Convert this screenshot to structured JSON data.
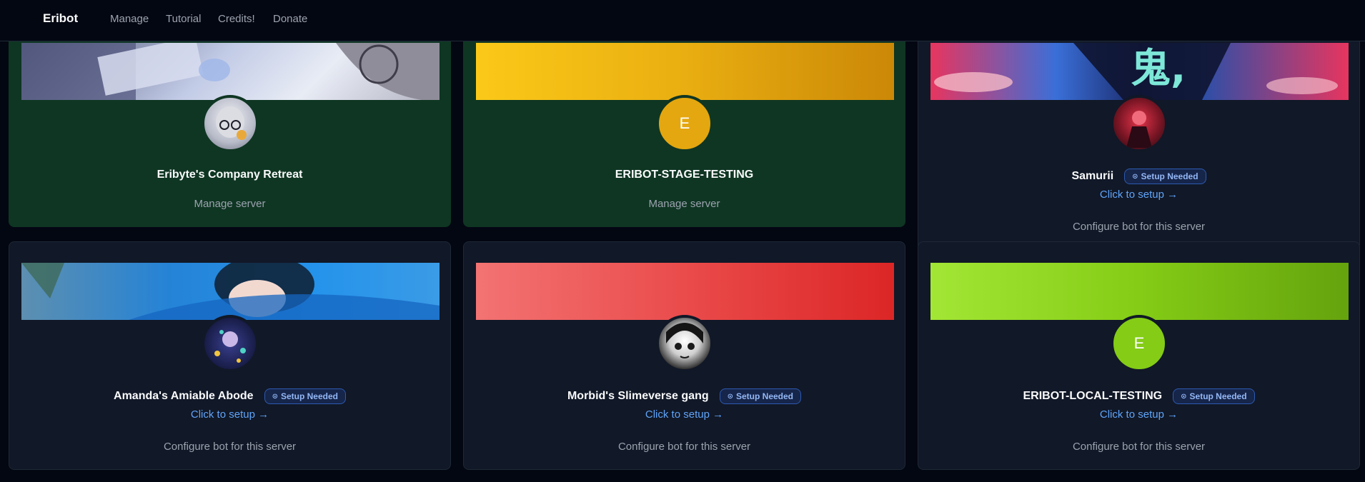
{
  "nav": {
    "brand": "Eribot",
    "links": [
      "Manage",
      "Tutorial",
      "Credits!",
      "Donate"
    ]
  },
  "servers": [
    {
      "name": "Eribyte's Company Retreat",
      "avatar_text": "",
      "action": "Manage server",
      "badge": "",
      "setup_link": "",
      "banner_color": "#7b8bb5",
      "avatar_color": "#cfd5e2"
    },
    {
      "name": "ERIBOT-STAGE-TESTING",
      "avatar_text": "E",
      "action": "Manage server",
      "badge": "",
      "setup_link": "",
      "banner_color": "#e9ad0e",
      "avatar_color": "#e4a70f"
    },
    {
      "name": "Samurii",
      "avatar_text": "",
      "action": "Configure bot for this server",
      "badge": "Setup Needed",
      "setup_link": "Click to setup →",
      "banner_color": "#e0345f",
      "avatar_color": "#7a1524"
    },
    {
      "name": "Amanda's Amiable Abode",
      "avatar_text": "",
      "action": "Configure bot for this server",
      "badge": "Setup Needed",
      "setup_link": "Click to setup →",
      "banner_color": "#2a8ee4",
      "avatar_color": "#1a1f4c"
    },
    {
      "name": "Morbid's Slimeverse gang",
      "avatar_text": "",
      "action": "Configure bot for this server",
      "badge": "Setup Needed",
      "setup_link": "Click to setup →",
      "banner_color": "#ea4849",
      "avatar_color": "#2b2b2b"
    },
    {
      "name": "ERIBOT-LOCAL-TESTING",
      "avatar_text": "E",
      "action": "Configure bot for this server",
      "badge": "Setup Needed",
      "setup_link": "Click to setup →",
      "banner_color": "#86cf23",
      "avatar_color": "#84cc16"
    }
  ]
}
